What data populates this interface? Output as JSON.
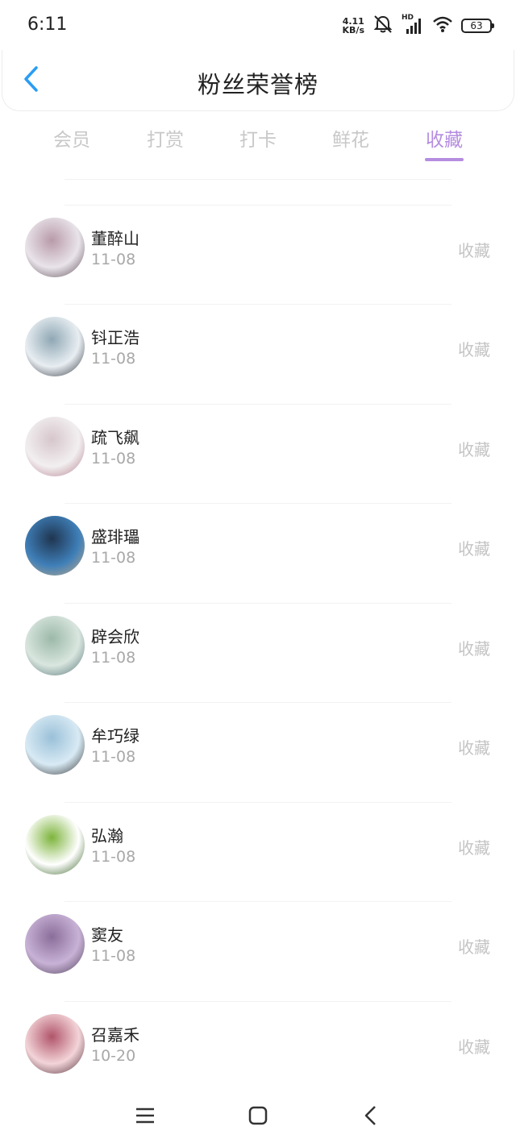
{
  "status_bar": {
    "time": "6:11",
    "net_speed_value": "4.11",
    "net_speed_unit": "KB/s",
    "network_badge": "HD",
    "battery": "63"
  },
  "header": {
    "title": "粉丝荣誉榜"
  },
  "tabs": [
    {
      "label": "会员",
      "active": false
    },
    {
      "label": "打赏",
      "active": false
    },
    {
      "label": "打卡",
      "active": false
    },
    {
      "label": "鲜花",
      "active": false
    },
    {
      "label": "收藏",
      "active": true
    }
  ],
  "fans": [
    {
      "name": "董醉山",
      "date": "11-08",
      "action": "收藏",
      "avatar_colors": [
        "#e9e4ea",
        "#b89aa8",
        "#5a4a52"
      ]
    },
    {
      "name": "钭正浩",
      "date": "11-08",
      "action": "收藏",
      "avatar_colors": [
        "#e8eef2",
        "#8fa7b4",
        "#2a2f38"
      ]
    },
    {
      "name": "疏飞飙",
      "date": "11-08",
      "action": "收藏",
      "avatar_colors": [
        "#f2eff0",
        "#d6c6cc",
        "#b07c8a"
      ]
    },
    {
      "name": "盛琲瓃",
      "date": "11-08",
      "action": "收藏",
      "avatar_colors": [
        "#3f7fb8",
        "#1f3550",
        "#c8ad88"
      ]
    },
    {
      "name": "辟会欣",
      "date": "11-08",
      "action": "收藏",
      "avatar_colors": [
        "#d9e6df",
        "#9bb8a8",
        "#4f6e72"
      ]
    },
    {
      "name": "牟巧绿",
      "date": "11-08",
      "action": "收藏",
      "avatar_colors": [
        "#d8eaf4",
        "#9ac0d8",
        "#2a2a2a"
      ]
    },
    {
      "name": "弘瀚",
      "date": "11-08",
      "action": "收藏",
      "avatar_colors": [
        "#ffffff",
        "#7db43c",
        "#2f5c1a"
      ]
    },
    {
      "name": "窦友",
      "date": "11-08",
      "action": "收藏",
      "avatar_colors": [
        "#c8b2d6",
        "#8a6e9a",
        "#4a3a52"
      ]
    },
    {
      "name": "召嘉禾",
      "date": "10-20",
      "action": "收藏",
      "avatar_colors": [
        "#f3d4d8",
        "#b0556a",
        "#4a2a34"
      ]
    }
  ],
  "icons": {
    "back": "chevron-left-icon",
    "menu": "menu-icon",
    "home": "home-icon",
    "nav_back": "nav-back-icon"
  },
  "colors": {
    "accent": "#b58de0",
    "back_arrow": "#2a9df4",
    "inactive_tab": "#c8c8c8",
    "muted_text": "#a8a8a8"
  }
}
